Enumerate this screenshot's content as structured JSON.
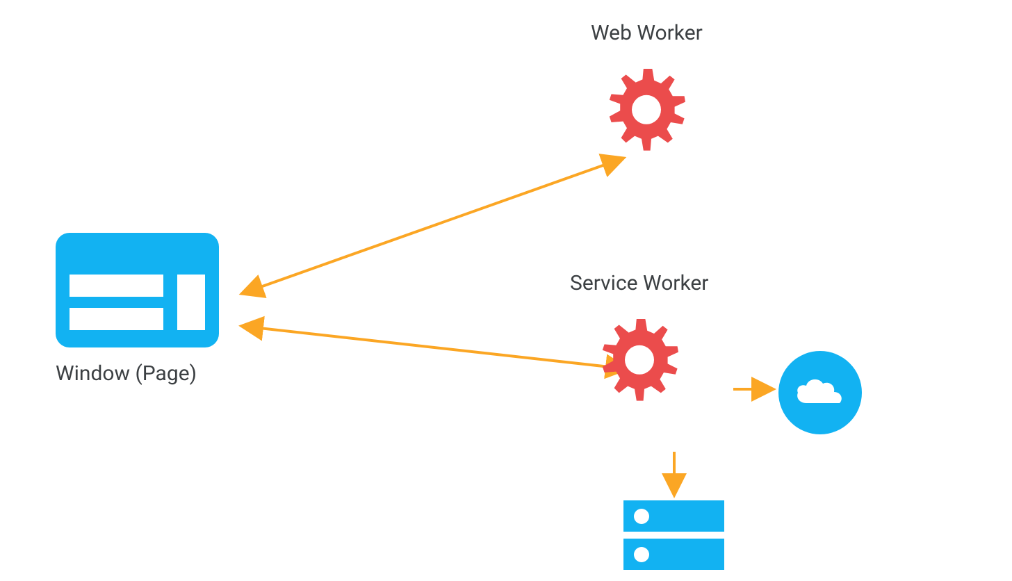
{
  "nodes": {
    "window": {
      "label": "Window (Page)"
    },
    "web_worker": {
      "label": "Web Worker"
    },
    "service_worker": {
      "label": "Service Worker"
    }
  },
  "colors": {
    "blue": "#12b2f2",
    "red": "#eb4c4c",
    "orange": "#fba624",
    "text": "#3c4043"
  },
  "edges": [
    {
      "from": "window",
      "to": "web_worker",
      "bidirectional": true
    },
    {
      "from": "window",
      "to": "service_worker",
      "bidirectional": true
    },
    {
      "from": "service_worker",
      "to": "cloud",
      "bidirectional": false
    },
    {
      "from": "service_worker",
      "to": "storage",
      "bidirectional": false
    }
  ]
}
